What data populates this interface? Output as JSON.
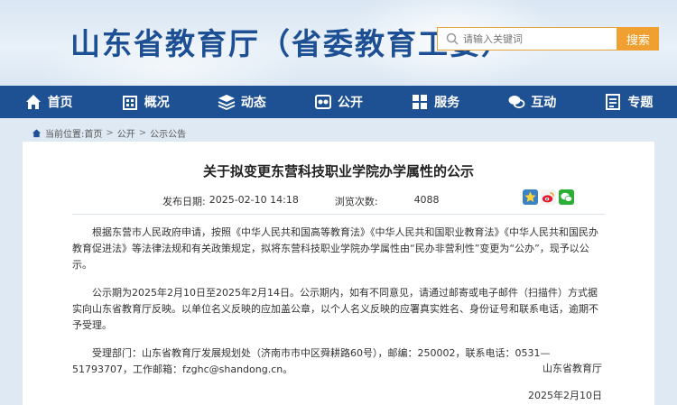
{
  "header": {
    "site_title": "山东省教育厅（省委教育工委）",
    "search_placeholder": "请输入关键词",
    "search_button": "搜索"
  },
  "nav": {
    "items": [
      {
        "label": "首页",
        "icon": "home-icon"
      },
      {
        "label": "概况",
        "icon": "building-icon"
      },
      {
        "label": "动态",
        "icon": "layers-icon"
      },
      {
        "label": "公开",
        "icon": "open-icon"
      },
      {
        "label": "服务",
        "icon": "service-icon"
      },
      {
        "label": "互动",
        "icon": "chat-icon"
      },
      {
        "label": "专题",
        "icon": "topic-icon"
      }
    ]
  },
  "breadcrumb": {
    "prefix": "当前位置:",
    "items": [
      "首页",
      "公开",
      "公示公告"
    ],
    "separator": ">"
  },
  "article": {
    "title": "关于拟变更东营科技职业学院办学属性的公示",
    "publish_label": "发布日期:",
    "publish_date": "2025-02-10 14:18",
    "views_label": "浏览次数:",
    "views": "4088",
    "paragraphs": [
      "根据东营市人民政府申请，按照《中华人民共和国高等教育法》《中华人民共和国职业教育法》《中华人民共和国民办教育促进法》等法律法规和有关政策规定，拟将东营科技职业学院办学属性由“民办非营利性”变更为“公办”，现予以公示。",
      "公示期为2025年2月10日至2025年2月14日。公示期内，如有不同意见，请通过邮寄或电子邮件（扫描件）方式据实向山东省教育厅反映。以单位名义反映的应加盖公章，以个人名义反映的应署真实姓名、身份证号和联系电话，逾期不予受理。",
      "受理部门：山东省教育厅发展规划处（济南市市中区舜耕路60号），邮编：250002，联系电话：0531—51793707，工作邮箱：fzghc@shandong.cn。"
    ],
    "signature": "山东省教育厅",
    "sign_date": "2025年2月10日"
  },
  "colors": {
    "nav_bg": "#1e5194",
    "title_blue": "#1d4f94",
    "search_orange": "#f0a030"
  }
}
